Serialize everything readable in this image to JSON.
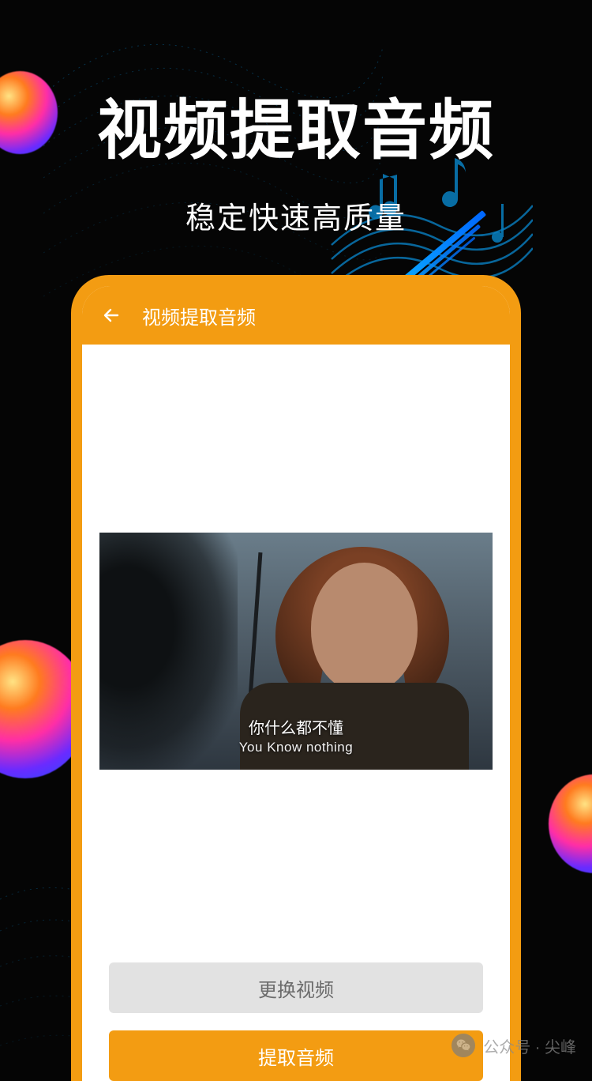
{
  "hero": {
    "title": "视频提取音频",
    "subtitle": "稳定快速高质量"
  },
  "appbar": {
    "title": "视频提取音频"
  },
  "video": {
    "subtitle_cn": "你什么都不懂",
    "subtitle_en": "You Know nothing"
  },
  "buttons": {
    "change_video": "更换视频",
    "extract_audio": "提取音频"
  },
  "watermark": {
    "label": "公众号 · 尖峰"
  },
  "colors": {
    "accent": "#F39C12"
  }
}
